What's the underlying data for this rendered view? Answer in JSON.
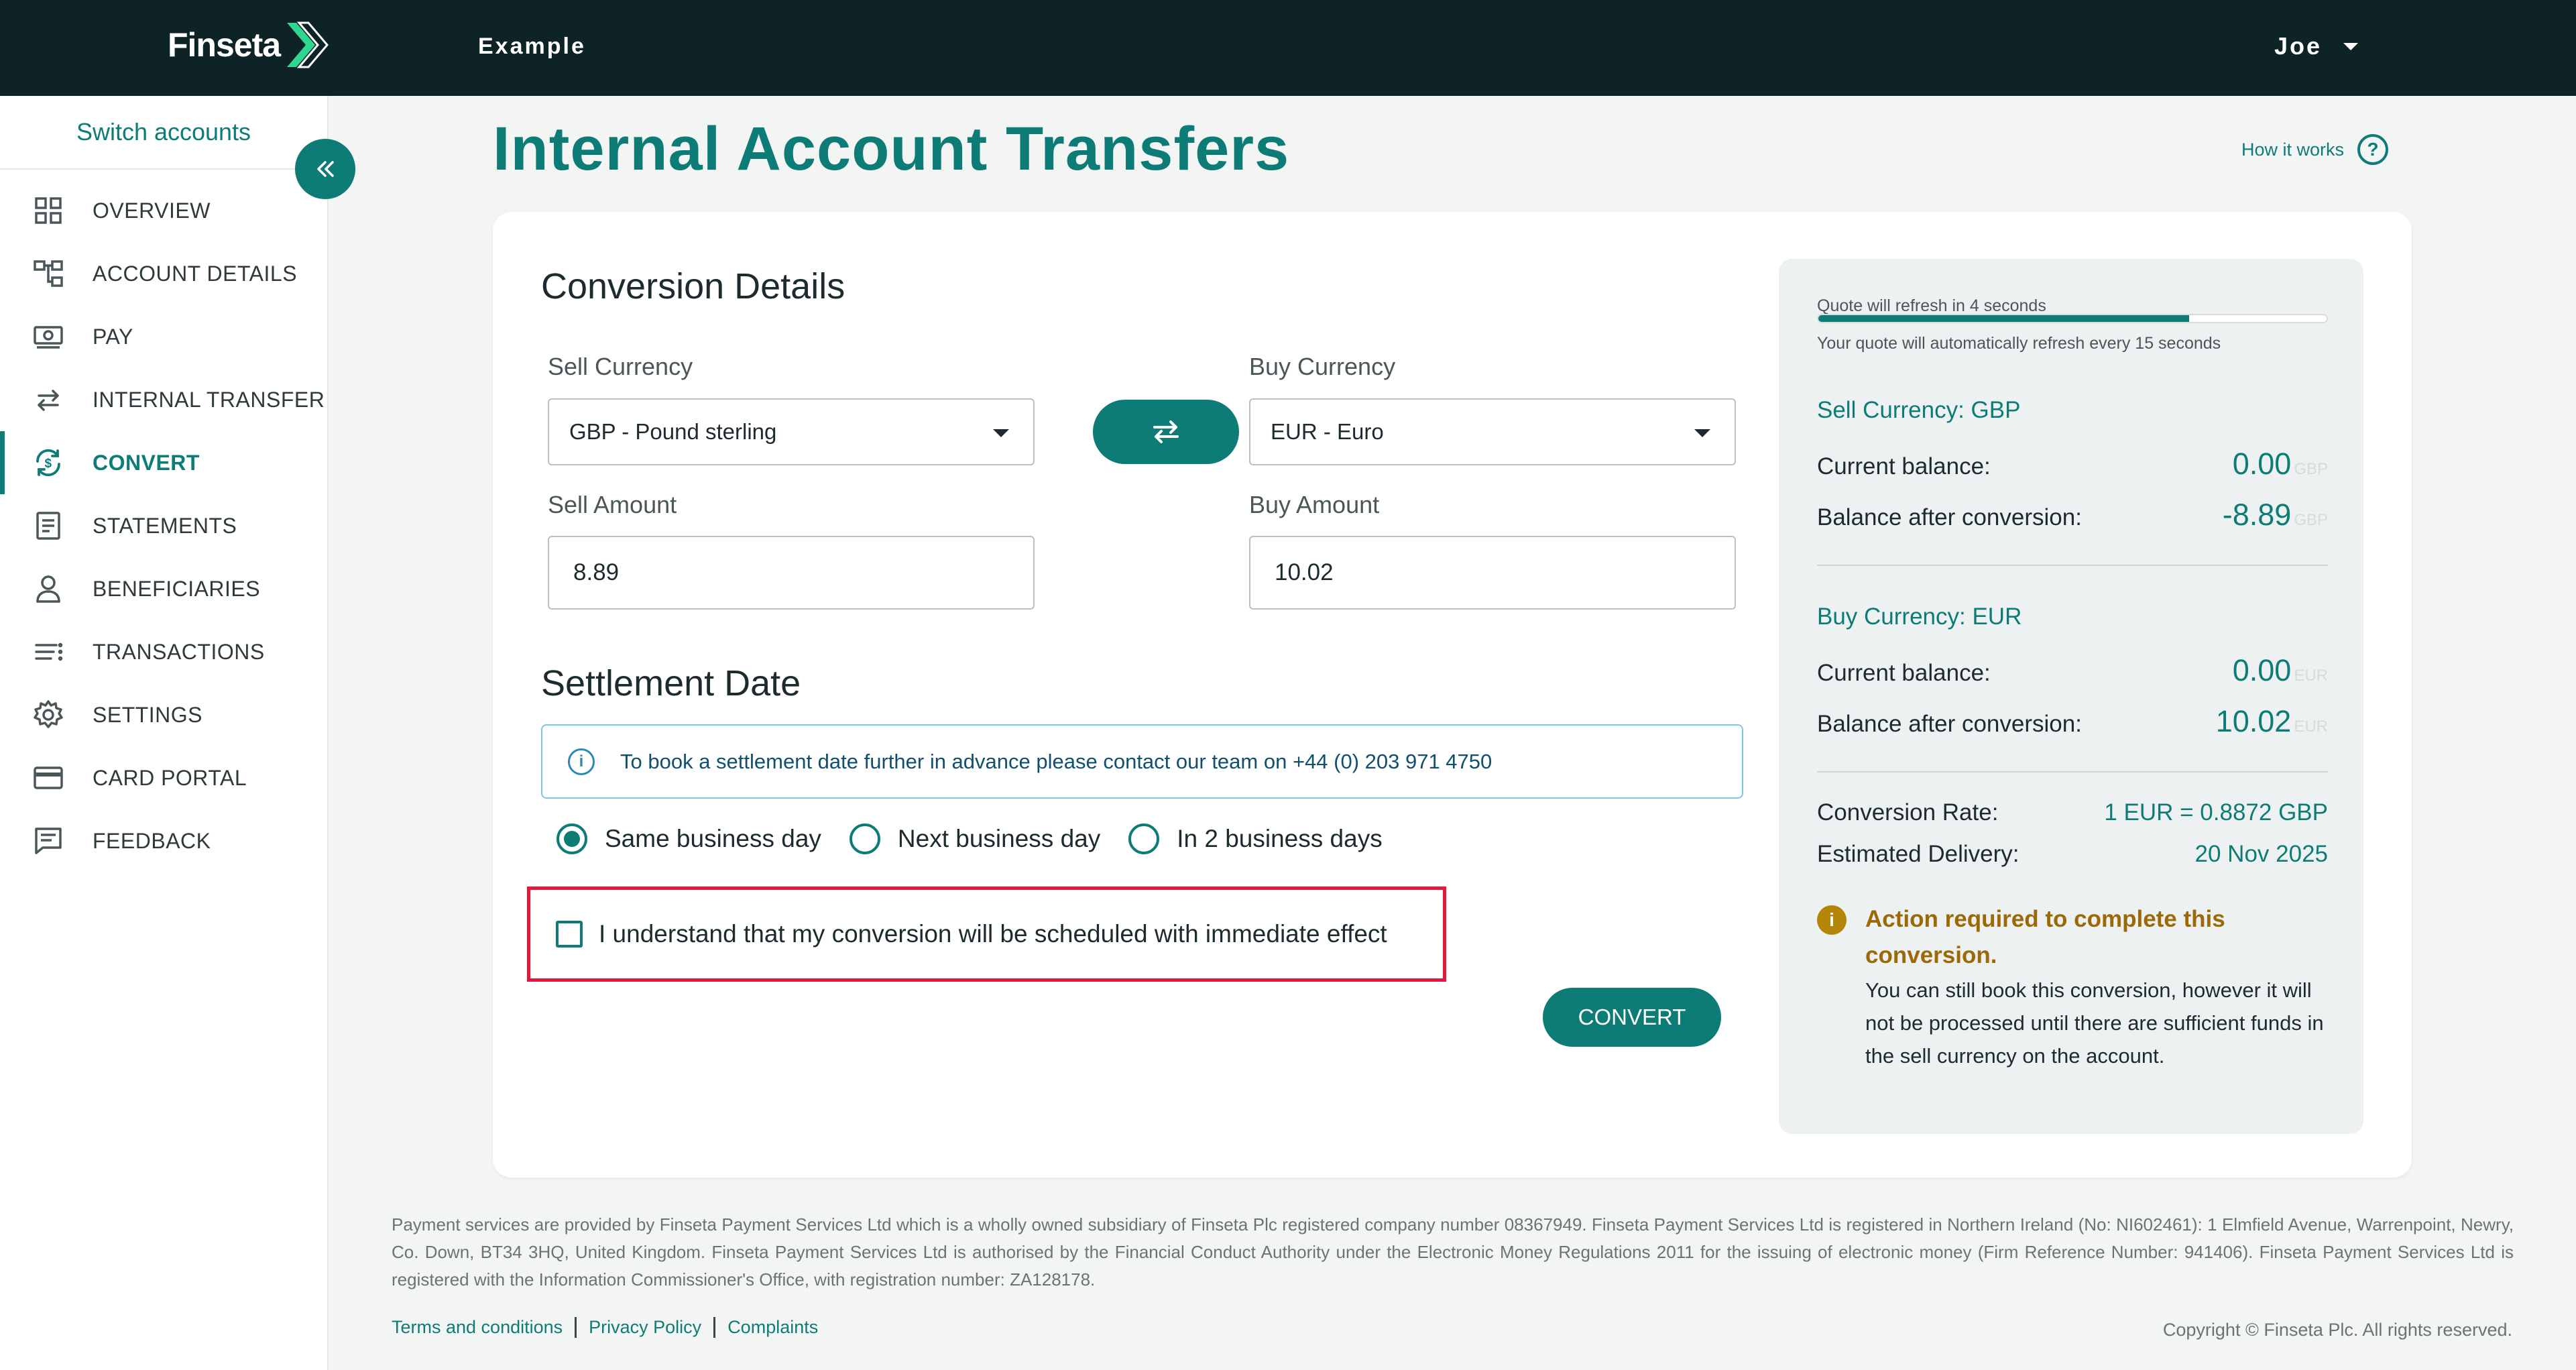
{
  "header": {
    "logo_text": "Finseta",
    "org_name": "Example",
    "user_name": "Joe"
  },
  "sidebar": {
    "switch_accounts": "Switch accounts",
    "items": [
      {
        "label": "OVERVIEW",
        "icon": "grid-icon"
      },
      {
        "label": "ACCOUNT DETAILS",
        "icon": "structure-icon"
      },
      {
        "label": "PAY",
        "icon": "cash-icon"
      },
      {
        "label": "INTERNAL TRANSFER",
        "icon": "arrows-icon"
      },
      {
        "label": "CONVERT",
        "icon": "convert-icon",
        "active": true
      },
      {
        "label": "STATEMENTS",
        "icon": "document-icon"
      },
      {
        "label": "BENEFICIARIES",
        "icon": "person-icon"
      },
      {
        "label": "TRANSACTIONS",
        "icon": "list-icon"
      },
      {
        "label": "SETTINGS",
        "icon": "gear-icon"
      },
      {
        "label": "CARD PORTAL",
        "icon": "card-icon"
      },
      {
        "label": "FEEDBACK",
        "icon": "feedback-icon"
      }
    ]
  },
  "page": {
    "title": "Internal Account Transfers",
    "how_it_works": "How it works"
  },
  "conversion": {
    "heading": "Conversion Details",
    "sell_currency_label": "Sell Currency",
    "sell_currency_value": "GBP - Pound sterling",
    "buy_currency_label": "Buy Currency",
    "buy_currency_value": "EUR - Euro",
    "sell_amount_label": "Sell Amount",
    "sell_amount_value": "8.89",
    "buy_amount_label": "Buy Amount",
    "buy_amount_value": "10.02"
  },
  "settlement": {
    "heading": "Settlement Date",
    "info_text": "To book a settlement date further in advance please contact our team on +44 (0) 203 971 4750",
    "options": [
      {
        "label": "Same business day",
        "selected": true
      },
      {
        "label": "Next business day",
        "selected": false
      },
      {
        "label": "In 2 business days",
        "selected": false
      }
    ],
    "confirm_text": "I understand that my conversion will be scheduled with immediate effect",
    "convert_button": "CONVERT"
  },
  "quote": {
    "refresh_text": "Quote will refresh in 4 seconds",
    "auto_refresh_text": "Your quote will automatically refresh every 15 seconds",
    "progress": 0.73,
    "sell_heading": "Sell Currency: GBP",
    "sell_current_label": "Current balance:",
    "sell_current_value": "0.00",
    "sell_current_unit": "GBP",
    "sell_after_label": "Balance after conversion:",
    "sell_after_value": "-8.89",
    "sell_after_unit": "GBP",
    "buy_heading": "Buy Currency: EUR",
    "buy_current_label": "Current balance:",
    "buy_current_value": "0.00",
    "buy_current_unit": "EUR",
    "buy_after_label": "Balance after conversion:",
    "buy_after_value": "10.02",
    "buy_after_unit": "EUR",
    "rate_label": "Conversion Rate:",
    "rate_value": "1 EUR = 0.8872 GBP",
    "delivery_label": "Estimated Delivery:",
    "delivery_value": "20 Nov 2025",
    "action_title": "Action required to complete this conversion.",
    "action_body": "You can still book this conversion, however it will not be processed until there are sufficient funds in the sell currency on the account."
  },
  "footer": {
    "legal": "Payment services are provided by Finseta Payment Services Ltd which is a wholly owned subsidiary of Finseta Plc registered company number 08367949. Finseta Payment Services Ltd is registered in Northern Ireland (No: NI602461): 1 Elmfield Avenue, Warrenpoint, Newry, Co. Down, BT34 3HQ, United Kingdom. Finseta Payment Services Ltd is authorised by the Financial Conduct Authority under the Electronic Money Regulations 2011 for the issuing of electronic money (Firm Reference Number: 941406). Finseta Payment Services Ltd is registered with the Information Commissioner's Office, with registration number: ZA128178.",
    "links": [
      "Terms and conditions",
      "Privacy Policy",
      "Complaints"
    ],
    "copyright": "Copyright © Finseta Plc. All rights reserved."
  },
  "colors": {
    "accent": "#0e7c76",
    "topbar": "#0d2326",
    "highlight_border": "#e0193c",
    "warning": "#b58509"
  }
}
